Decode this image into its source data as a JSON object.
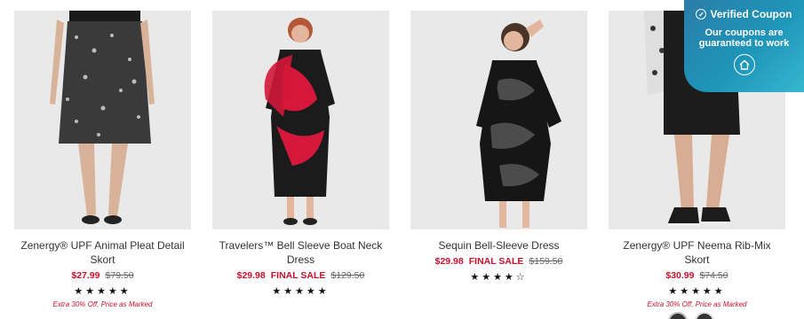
{
  "products": [
    {
      "name": "Zenergy® UPF Animal Pleat Detail Skort",
      "price": "$27.99",
      "final_label": "",
      "original_price": "$79.50",
      "rating_stars": "★★★★★",
      "promo": "Extra 30% Off, Price as Marked"
    },
    {
      "name": "Travelers™ Bell Sleeve Boat Neck Dress",
      "price": "$29.98",
      "final_label": "FINAL SALE",
      "original_price": "$129.50",
      "rating_stars": "★★★★★",
      "promo": ""
    },
    {
      "name": "Sequin Bell-Sleeve Dress",
      "price": "$29.98",
      "final_label": "FINAL SALE",
      "original_price": "$159.50",
      "rating_stars": "★★★★☆",
      "promo": ""
    },
    {
      "name": "Zenergy® UPF Neema Rib-Mix Skort",
      "price": "$30.99",
      "final_label": "",
      "original_price": "$74.50",
      "rating_stars": "★★★★★",
      "promo": "Extra 30% Off, Price as Marked"
    }
  ],
  "coupon": {
    "title": "Verified Coupon",
    "subtitle": "Our coupons are guaranteed to work",
    "icon": "home-icon"
  },
  "colors": {
    "sale_red": "#c8102e",
    "coupon_blue": "#1e95b9"
  }
}
